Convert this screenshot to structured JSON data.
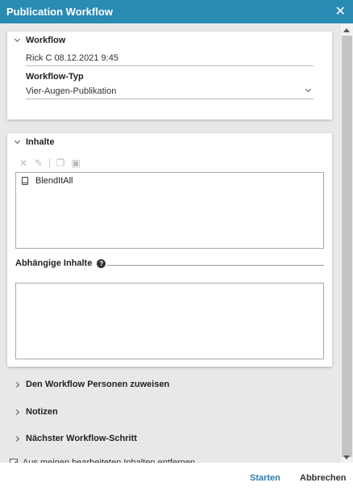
{
  "window": {
    "title": "Publication Workflow"
  },
  "workflow_panel": {
    "header": "Workflow",
    "workflow_value": "Rick C 08.12.2021 9:45",
    "type_label": "Workflow-Typ",
    "type_value": "Vier-Augen-Publikation"
  },
  "content_panel": {
    "header": "Inhalte",
    "items": [
      {
        "label": "BlendItAll",
        "icon": "book-icon"
      }
    ],
    "dependent_label": "Abhängige Inhalte",
    "dependent_items": []
  },
  "sections": {
    "assign_persons": "Den Workflow Personen zuweisen",
    "notes": "Notizen",
    "next_step": "Nächster Workflow-Schritt"
  },
  "option": {
    "remove_from_edited": "Aus meinen bearbeiteten Inhalten entfernen",
    "checked": true
  },
  "footer": {
    "start": "Starten",
    "cancel": "Abbrechen"
  },
  "colors": {
    "accent": "#2a8bb5",
    "link": "#2a7db0",
    "background": "#e8e8e8"
  }
}
